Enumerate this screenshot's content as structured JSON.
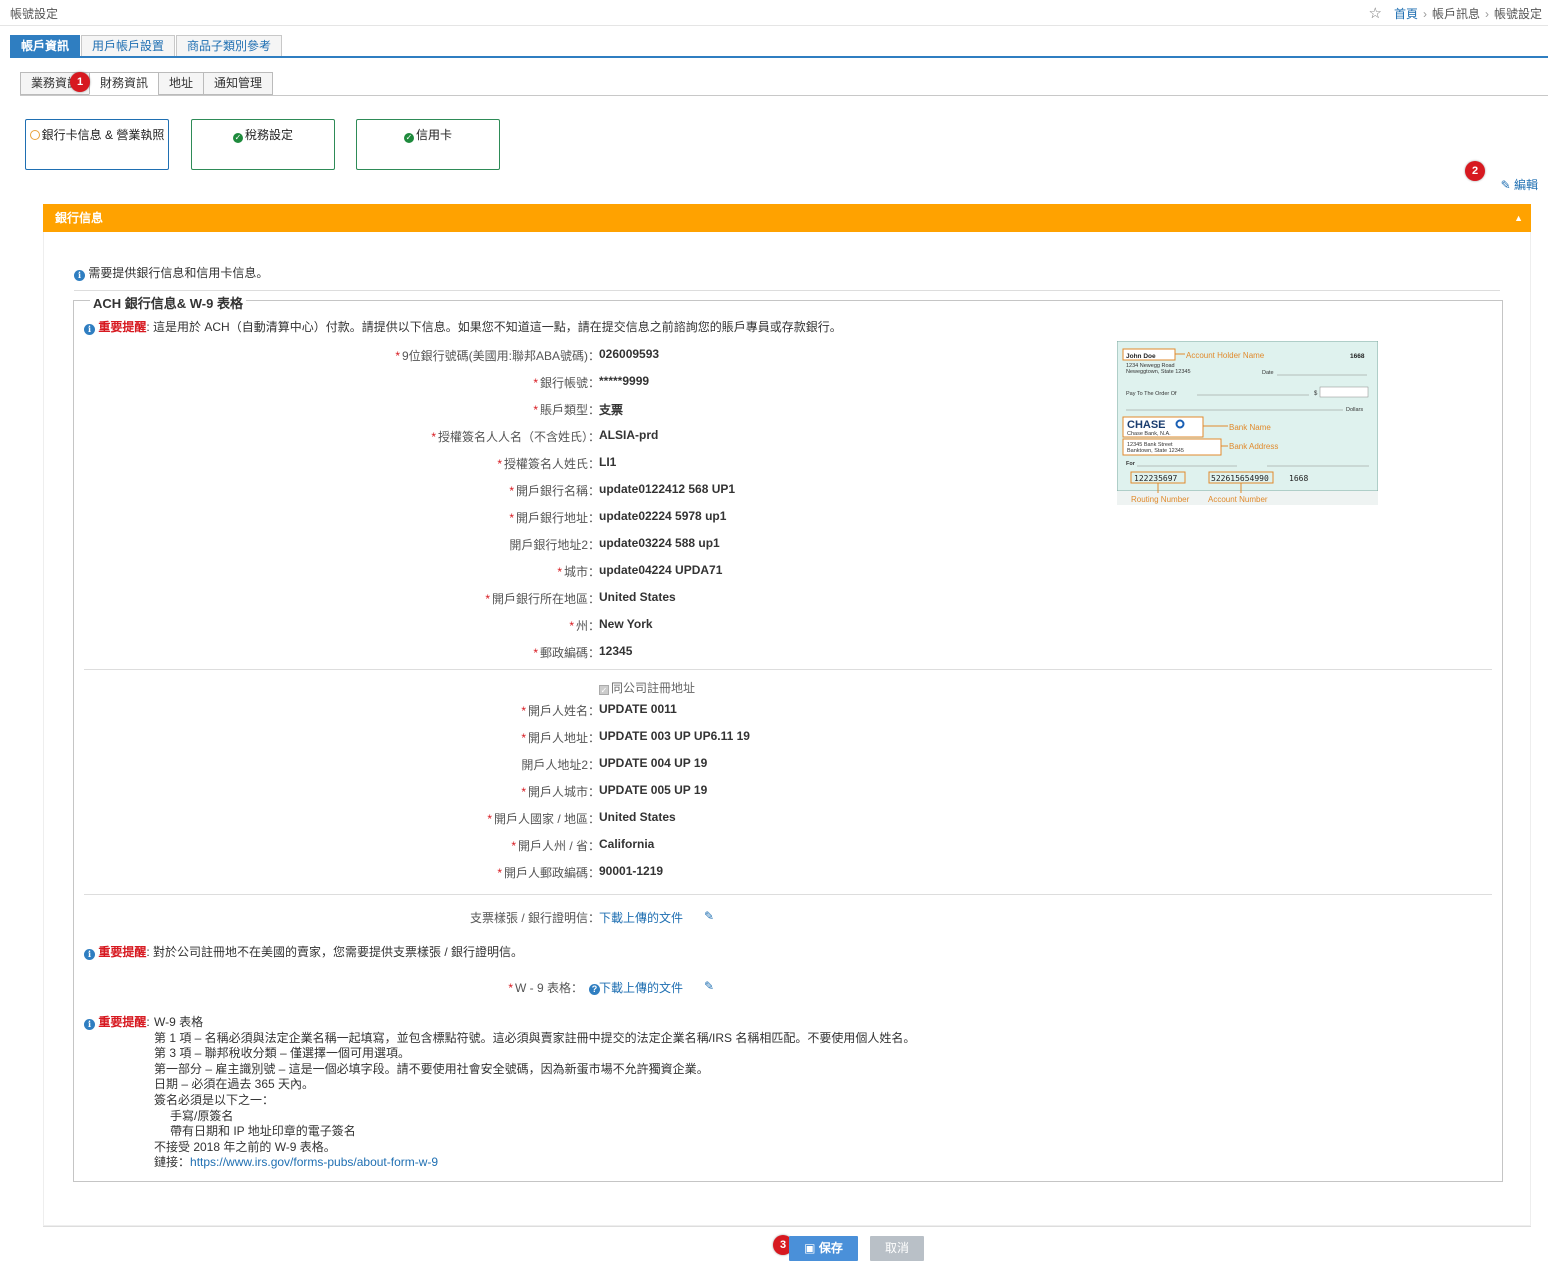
{
  "page_title": "帳號設定",
  "breadcrumb": {
    "home": "首頁",
    "parent": "帳戶訊息",
    "current": "帳號設定"
  },
  "main_tabs": [
    "帳戶資訊",
    "用戶帳戶設置",
    "商品子類別參考"
  ],
  "sub_tabs": [
    "業務資訊",
    "財務資訊",
    "地址",
    "通知管理"
  ],
  "badges": [
    "1",
    "2",
    "3"
  ],
  "status_cards": [
    {
      "label": "銀行卡信息 & 營業執照",
      "status": "warning"
    },
    {
      "label": "稅務設定",
      "status": "complete"
    },
    {
      "label": "信用卡",
      "status": "complete"
    }
  ],
  "edit_label": "編輯",
  "panel_title": "銀行信息",
  "top_note": "需要提供銀行信息和信用卡信息。",
  "ach": {
    "legend": "ACH 銀行信息& W-9 表格",
    "warn_label": "重要提醒",
    "warn_text": ": 這是用於 ACH（自動清算中心）付款。請提供以下信息。如果您不知道這一點，請在提交信息之前諮詢您的賬戶專員或存款銀行。",
    "bank_fields": [
      {
        "label": "9位銀行號碼(美國用:聯邦ABA號碼)：",
        "value": "026009593",
        "required": true
      },
      {
        "label": "銀行帳號：",
        "value": "*****9999",
        "required": true
      },
      {
        "label": "賬戶類型：",
        "value": "支票",
        "required": true
      },
      {
        "label": "授權簽名人人名（不含姓氏）：",
        "value": "ALSIA-prd",
        "required": true
      },
      {
        "label": "授權簽名人姓氏：",
        "value": "LI1",
        "required": true
      },
      {
        "label": "開戶銀行名稱：",
        "value": "update0122412 568 UP1",
        "required": true
      },
      {
        "label": "開戶銀行地址：",
        "value": "update02224 5978 up1",
        "required": true
      },
      {
        "label": "開戶銀行地址2：",
        "value": "update03224 588 up1",
        "required": false
      },
      {
        "label": "城市：",
        "value": "update04224 UPDA71",
        "required": true
      },
      {
        "label": "開戶銀行所在地區：",
        "value": "United States",
        "required": true
      },
      {
        "label": "州：",
        "value": "New York",
        "required": true
      },
      {
        "label": "郵政編碼：",
        "value": "12345",
        "required": true
      }
    ],
    "same_address_label": "同公司註冊地址",
    "holder_fields": [
      {
        "label": "開戶人姓名：",
        "value": "UPDATE 0011",
        "required": true
      },
      {
        "label": "開戶人地址：",
        "value": "UPDATE 003 UP UP6.11 19",
        "required": true
      },
      {
        "label": "開戶人地址2：",
        "value": "UPDATE 004 UP 19",
        "required": false
      },
      {
        "label": "開戶人城市：",
        "value": "UPDATE 005 UP 19",
        "required": true
      },
      {
        "label": "開戶人國家 / 地區：",
        "value": "United States",
        "required": true
      },
      {
        "label": "開戶人州 / 省：",
        "value": "California",
        "required": true
      },
      {
        "label": "開戶人郵政編碼：",
        "value": "90001-1219",
        "required": true
      }
    ],
    "check_label": "支票樣張 / 銀行證明信：",
    "download_label": "下載上傳的文件",
    "check_warn_label": "重要提醒",
    "check_warn_text": ": 對於公司註冊地不在美國的賣家，您需要提供支票樣張 / 銀行證明信。",
    "w9_label": "W - 9 表格：",
    "w9_warn_label": "重要提醒",
    "w9_lines": [
      "W-9 表格",
      "第 1 項 – 名稱必須與法定企業名稱一起填寫，並包含標點符號。這必須與賣家註冊中提交的法定企業名稱/IRS 名稱相匹配。不要使用個人姓名。",
      "第 3 項 – 聯邦稅收分類 – 僅選擇一個可用選項。",
      "第一部分 – 雇主識別號 – 這是一個必填字段。請不要使用社會安全號碼，因為新蛋市場不允許獨資企業。",
      "日期 – 必須在過去 365 天內。",
      "簽名必須是以下之一：",
      "手寫/原簽名",
      "帶有日期和 IP 地址印章的電子簽名",
      "不接受 2018 年之前的 W-9 表格。"
    ],
    "w9_link_prefix": "鏈接：",
    "w9_link": "https://www.irs.gov/forms-pubs/about-form-w-9"
  },
  "check_image": {
    "holder": "John Doe",
    "number": "1668",
    "address1": "1234 Newegg Road",
    "address2": "Neweggtown, State 12345",
    "date": "Date",
    "pay": "Pay To The Order Of",
    "dollar": "$",
    "dollars": "Dollars",
    "bank": "CHASE",
    "bank_sub": "Chase Bank, N.A.",
    "bank_addr1": "12345 Bank Street",
    "bank_addr2": "Banktown, State 12345",
    "for": "For",
    "routing": "122235697",
    "account": "522615654990",
    "check_no": "1668",
    "ann_holder": "Account Holder Name",
    "ann_bank": "Bank Name",
    "ann_address": "Bank Address",
    "ann_routing": "Routing Number",
    "ann_account": "Account Number"
  },
  "buttons": {
    "save": "保存",
    "cancel": "取消"
  }
}
